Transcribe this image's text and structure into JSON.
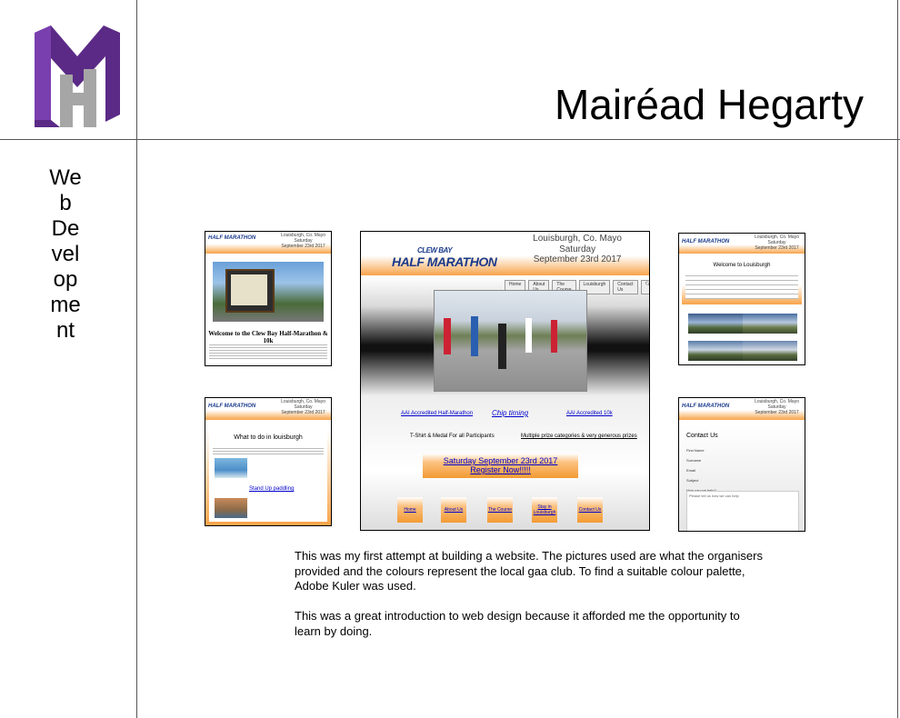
{
  "name": "Mairéad Hegarty",
  "section_vertical": "Web\nDevelopment",
  "paragraphs": [
    "This was my first attempt at building a website. The pictures used are what the organisers provided and the colours represent the local gaa club. To find a suitable colour palette, Adobe Kuler was used.",
    "This was a great introduction to web design because it afforded me the opportunity to learn by doing."
  ],
  "site": {
    "location": "Louisburgh, Co. Mayo",
    "day": "Saturday",
    "date": "September 23rd 2017",
    "brand_top": "CLEW BAY",
    "brand_main": "HALF MARATHON",
    "brand_sub": "& 10k",
    "nav": [
      "Home",
      "About Us",
      "The Course",
      "Louisburgh",
      "Contact Us"
    ],
    "main_links": [
      "AAI Accredited Half-Marathon",
      "Chip timing",
      "AAI Accredited 10k"
    ],
    "main_features": [
      "T-Shirt & Medal For all Participants",
      "Multiple prize categories & very generous prizes"
    ],
    "register_line1": "Saturday September 23rd 2017",
    "register_line2": "Register Now!!!!!",
    "footer_buttons": [
      "Home",
      "About Us",
      "The Course",
      "Stay in Louisburgh",
      "Contact Us"
    ],
    "welcome_title": "Welcome to the Clew Bay Half-Marathon & 10k",
    "welcome_small": "Welcome to Louisburgh",
    "todo_title": "What to do in louisburgh",
    "todo_link": "Stand Up paddling",
    "contact_title": "Contact Us",
    "contact_fields": [
      "First Name",
      "Surname",
      "Email",
      "Subject",
      "How can we help?"
    ],
    "contact_placeholder": "Please tell us how we can help"
  },
  "colors": {
    "logo_purple": "#5b2a86",
    "logo_grey": "#a6a6a6",
    "accent_orange": "#f39a33"
  }
}
